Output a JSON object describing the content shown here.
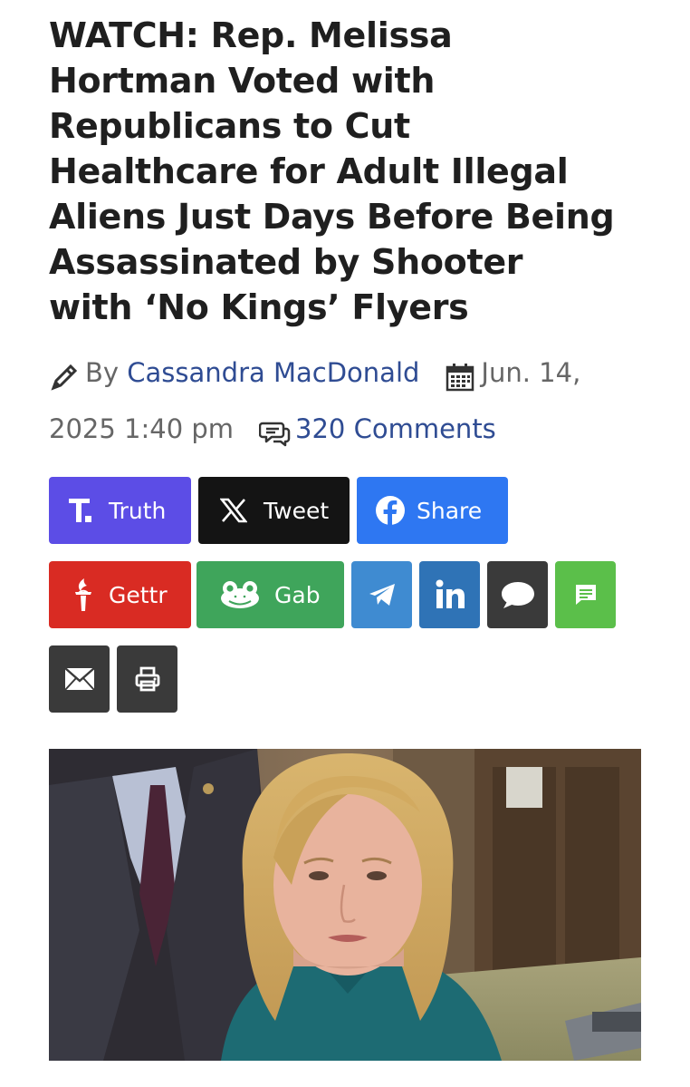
{
  "article": {
    "headline_lines": [
      "WATCH: Rep. Melissa",
      "Hortman Voted with",
      "Republicans to Cut",
      "Healthcare for Adult Illegal",
      "Aliens Just Days Before Being",
      "Assassinated by Shooter",
      "with ‘No Kings’ Flyers"
    ],
    "byline_prefix": "By",
    "author": "Cassandra MacDonald",
    "date_part1": "Jun. 14,",
    "date_part2": "2025 1:40 pm",
    "comments": "320 Comments"
  },
  "share_buttons": {
    "truth": "Truth",
    "tweet": "Tweet",
    "share": "Share",
    "gettr": "Gettr",
    "gab": "Gab"
  },
  "icons": {
    "author": "pencil-icon",
    "date": "calendar-icon",
    "comments": "comments-icon",
    "telegram": "telegram-icon",
    "linkedin": "linkedin-icon",
    "sms": "speech-bubble-icon",
    "message": "message-icon",
    "email": "envelope-icon",
    "print": "printer-icon"
  },
  "colors": {
    "truth": "#5c4de6",
    "tweet": "#141414",
    "facebook": "#2e77f2",
    "gettr": "#d92b23",
    "gab": "#3fa55b",
    "telegram": "#3f8bd1",
    "linkedin": "#2f73b6",
    "sms": "#3a3a3a",
    "message": "#5bbf4a",
    "email": "#3a3a3a",
    "print": "#3a3a3a",
    "link": "#2f4c93"
  }
}
